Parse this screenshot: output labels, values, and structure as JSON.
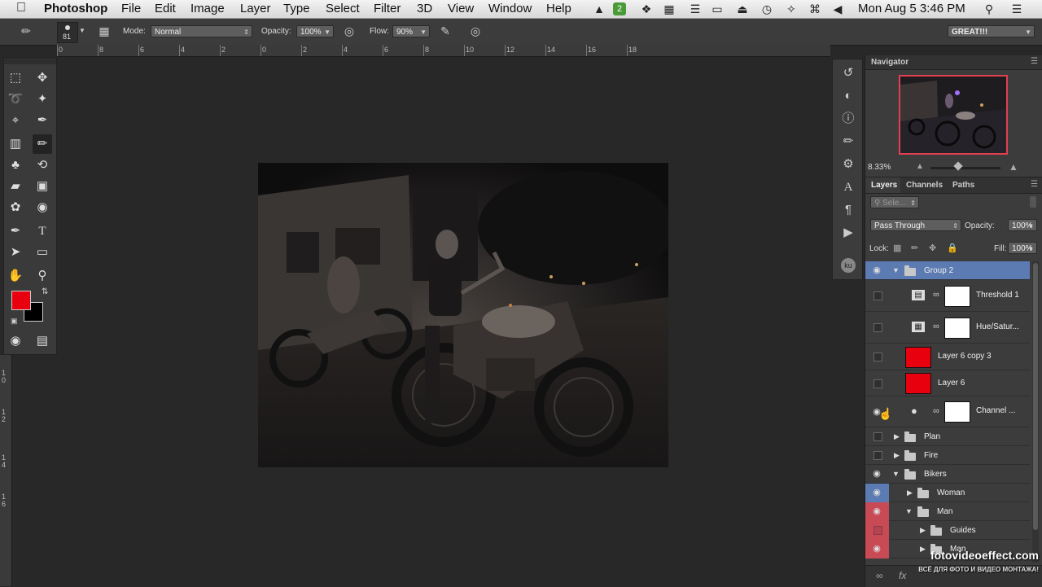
{
  "menubar": {
    "apple": "",
    "app": "Photoshop",
    "items": [
      "File",
      "Edit",
      "Image",
      "Layer",
      "Type",
      "Select",
      "Filter",
      "3D",
      "View",
      "Window",
      "Help"
    ],
    "clock": "Mon Aug 5  3:46 PM"
  },
  "options": {
    "brush_size": "81",
    "mode_label": "Mode:",
    "mode_value": "Normal",
    "opacity_label": "Opacity:",
    "opacity_value": "100%",
    "flow_label": "Flow:",
    "flow_value": "90%",
    "workspace": "GREAT!!!"
  },
  "ruler": {
    "h_ticks": [
      "0",
      "8",
      "6",
      "4",
      "2",
      "0",
      "2",
      "4",
      "6",
      "8",
      "10",
      "12",
      "14",
      "16",
      "18"
    ],
    "v_ticks": [
      "1\n0",
      "1\n2",
      "1\n4",
      "1\n6"
    ]
  },
  "colors": {
    "foreground": "#e8000f",
    "background": "#000000",
    "selection": "#5b7bb2",
    "red_highlight": "#c84a55"
  },
  "navigator": {
    "title": "Navigator",
    "zoom": "8.33%"
  },
  "layers_panel": {
    "tabs": [
      "Layers",
      "Channels",
      "Paths"
    ],
    "search_placeholder": "Sele...",
    "blend_mode": "Pass Through",
    "opacity_label": "Opacity:",
    "opacity_value": "100%",
    "lock_label": "Lock:",
    "fill_label": "Fill:",
    "fill_value": "100%",
    "layers": [
      {
        "name": "Group 2"
      },
      {
        "name": "Threshold 1"
      },
      {
        "name": "Hue/Satur..."
      },
      {
        "name": "Layer 6 copy 3"
      },
      {
        "name": "Layer 6"
      },
      {
        "name": "Channel ..."
      },
      {
        "name": "Plan"
      },
      {
        "name": "Fire"
      },
      {
        "name": "Bikers"
      },
      {
        "name": "Woman"
      },
      {
        "name": "Man"
      },
      {
        "name": "Guides"
      },
      {
        "name": "Man"
      }
    ]
  },
  "watermark": {
    "line1": "fotovideoeffect.com",
    "line2": "ВСЁ ДЛЯ ФОТО И ВИДЕО МОНТАЖА!"
  }
}
